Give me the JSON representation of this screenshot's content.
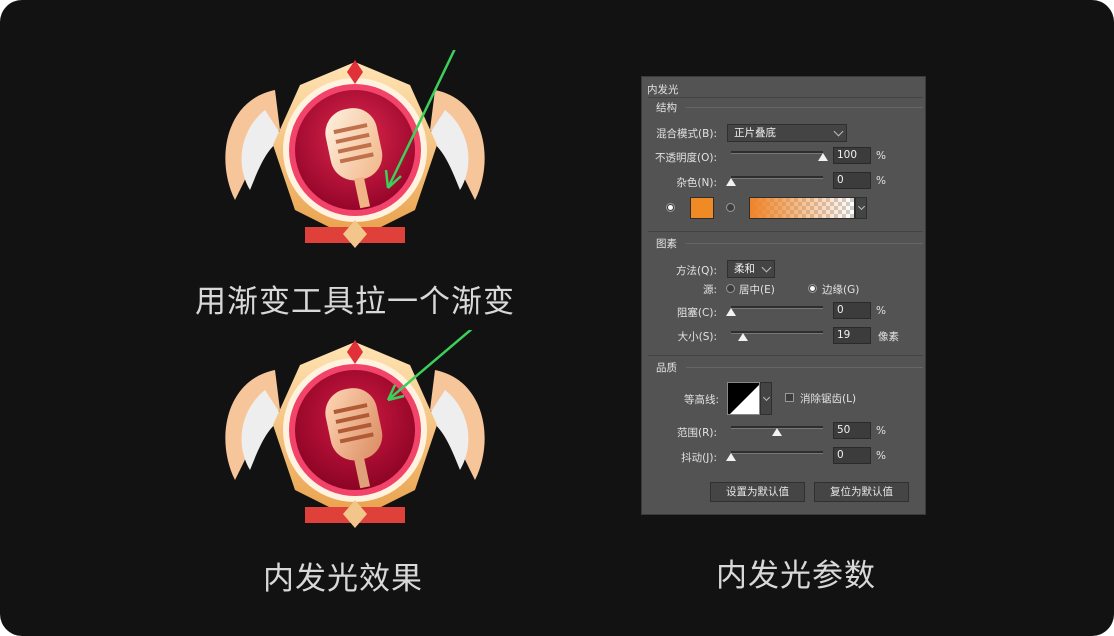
{
  "captions": {
    "step1": "用渐变工具拉一个渐变",
    "result": "内发光效果",
    "params": "内发光参数"
  },
  "dialog": {
    "title": "内发光",
    "structure": {
      "heading": "结构",
      "blend_mode_label": "混合模式(B):",
      "blend_mode_value": "正片叠底",
      "opacity_label": "不透明度(O):",
      "opacity_value": "100",
      "opacity_unit": "%",
      "noise_label": "杂色(N):",
      "noise_value": "0",
      "noise_unit": "%",
      "color_swatch": "#f08a24",
      "gradient_from": "#ee8428"
    },
    "elements": {
      "heading": "图素",
      "technique_label": "方法(Q):",
      "technique_value": "柔和",
      "source_label": "源:",
      "source_center": "居中(E)",
      "source_edge": "边缘(G)",
      "choke_label": "阻塞(C):",
      "choke_value": "0",
      "choke_unit": "%",
      "size_label": "大小(S):",
      "size_value": "19",
      "size_unit": "像素"
    },
    "quality": {
      "heading": "品质",
      "contour_label": "等高线:",
      "antialias_label": "消除锯齿(L)",
      "range_label": "范围(R):",
      "range_value": "50",
      "range_unit": "%",
      "jitter_label": "抖动(J):",
      "jitter_value": "0",
      "jitter_unit": "%"
    },
    "buttons": {
      "make_default": "设置为默认值",
      "reset_default": "复位为默认值"
    }
  },
  "colors": {
    "arrow": "#3ccf5a",
    "badge_red": "#c8103a",
    "badge_gold": "#f3c07a"
  }
}
